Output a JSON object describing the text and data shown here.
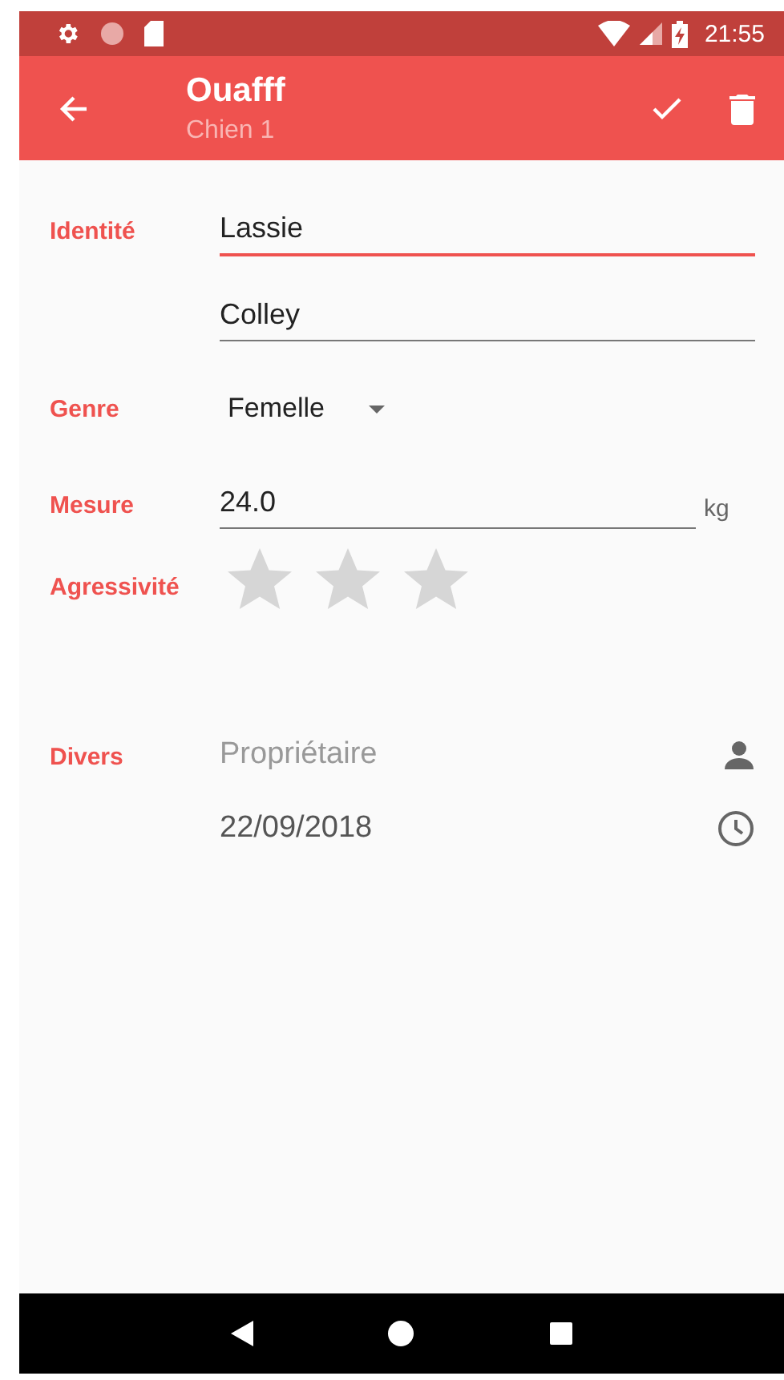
{
  "status_bar": {
    "time": "21:55"
  },
  "app_bar": {
    "title": "Ouafff",
    "subtitle": "Chien 1"
  },
  "form": {
    "identity": {
      "label": "Identité",
      "fields": [
        {
          "value": "Lassie",
          "focused": true
        },
        {
          "value": "Colley",
          "focused": false
        }
      ]
    },
    "gender": {
      "label": "Genre",
      "value": "Femelle"
    },
    "measure": {
      "label": "Mesure",
      "value": "24.0",
      "unit": "kg",
      "focused": false
    },
    "aggressiveness": {
      "label": "Agressivité",
      "stars": 0
    },
    "misc": {
      "label": "Divers",
      "items": [
        {
          "kind": "owner",
          "placeholder": "Propriétaire"
        },
        {
          "kind": "date",
          "value": "22/09/2018"
        }
      ]
    }
  }
}
